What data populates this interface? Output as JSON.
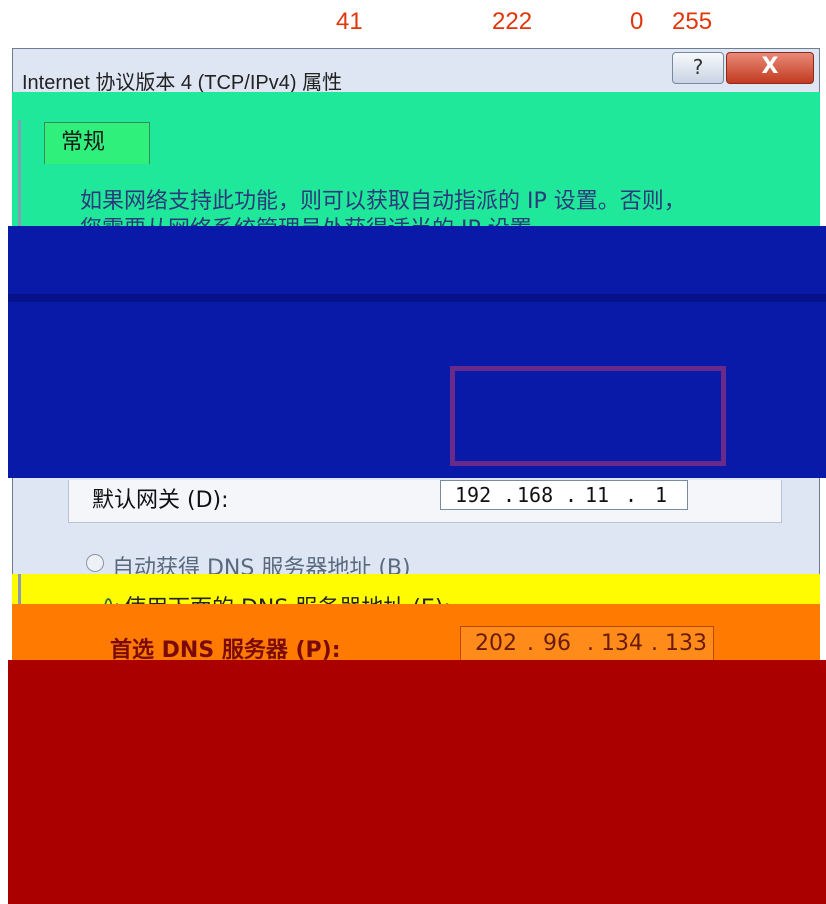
{
  "top_numbers": [
    "41",
    "222",
    "0",
    "255"
  ],
  "window": {
    "title": "Internet 协议版本 4 (TCP/IPv4) 属性",
    "help_label": "?",
    "close_label": "X"
  },
  "tab": {
    "label": "常规"
  },
  "description": {
    "line1": "如果网络支持此功能，则可以获取自动指派的 IP 设置。否则，",
    "line2": "您需要从网络系统管理员处获得适当的 IP 设置。"
  },
  "gateway": {
    "label": "默认网关 (D):",
    "octets": [
      "192",
      "168",
      "11",
      "1"
    ]
  },
  "dns": {
    "auto_label": "自动获得 DNS 服务器地址 (B)",
    "manual_label": "使用下面的 DNS 服务器地址 (E):",
    "preferred_label": "首选 DNS 服务器 (P):",
    "preferred_octets": [
      "202",
      "96",
      "134",
      "133"
    ]
  },
  "icons": {
    "radio_manual": "∿"
  },
  "colors": {
    "green": "#1fe89a",
    "blue": "#0a1aa8",
    "yellow": "#fffb00",
    "orange": "#ff7a00",
    "red": "#aa0000",
    "number_color": "#e2350a"
  }
}
